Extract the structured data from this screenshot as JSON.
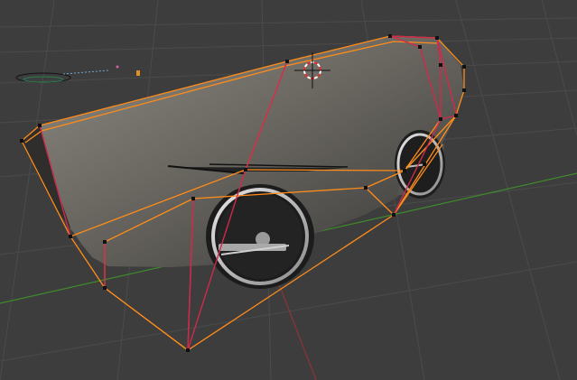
{
  "viewport": {
    "title": "",
    "colors": {
      "background": "#3d3d3d",
      "grid": "#4a4a4a",
      "axis_x": "#9a3a3a",
      "axis_y": "#3e8a2a",
      "cage_edge": "#ff8c1a",
      "seam_edge": "#d02a4a",
      "vertex": "#111111",
      "mesh_body": "#6f6c66",
      "wheel_rim": "#c9c9c9",
      "tire": "#1e1e1e"
    },
    "icons": {
      "cursor": "3d-cursor-icon",
      "light": "lamp-icon",
      "camera": "camera-icon"
    }
  }
}
